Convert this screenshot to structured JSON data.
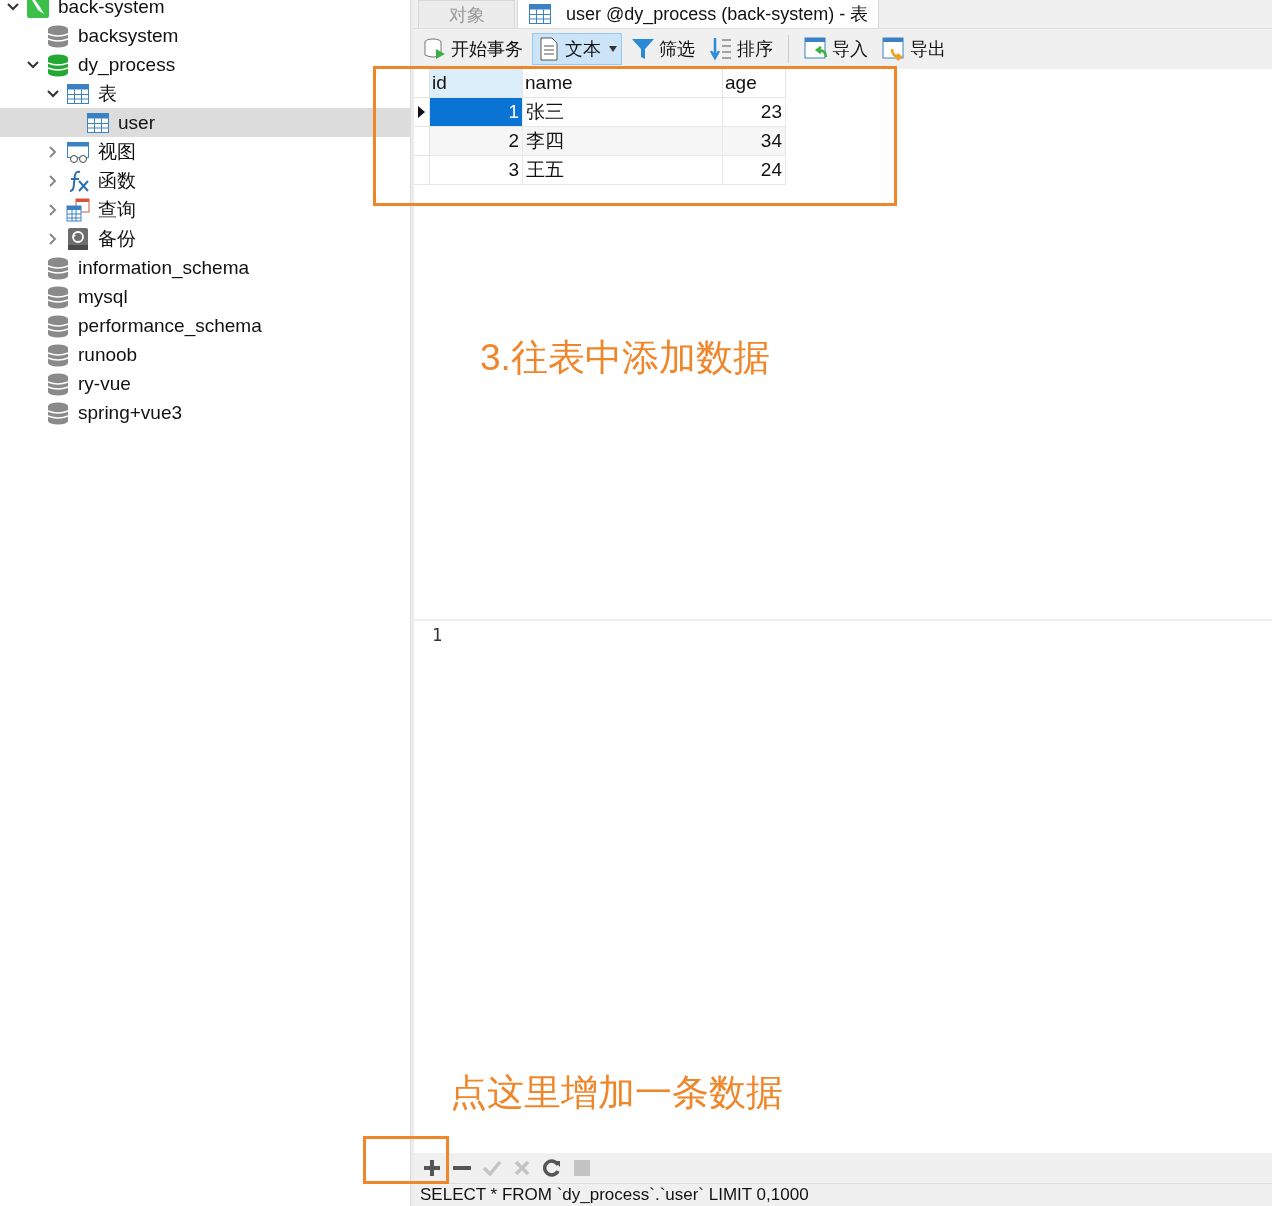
{
  "navigator": {
    "items": [
      {
        "label": "back-system",
        "kind": "connection",
        "expanded": true,
        "selected": false,
        "children": [
          {
            "label": "backsystem",
            "kind": "database",
            "open": false,
            "selected": false
          },
          {
            "label": "dy_process",
            "kind": "database",
            "open": true,
            "expanded": true,
            "selected": false,
            "children": [
              {
                "label": "表",
                "kind": "tables",
                "expanded": true,
                "selected": false,
                "children": [
                  {
                    "label": "user",
                    "kind": "table",
                    "selected": true
                  }
                ]
              },
              {
                "label": "视图",
                "kind": "views",
                "expanded": false,
                "selected": false
              },
              {
                "label": "函数",
                "kind": "functions",
                "expanded": false,
                "selected": false
              },
              {
                "label": "查询",
                "kind": "queries",
                "expanded": false,
                "selected": false
              },
              {
                "label": "备份",
                "kind": "backups",
                "expanded": false,
                "selected": false
              }
            ]
          },
          {
            "label": "information_schema",
            "kind": "database",
            "open": false,
            "selected": false
          },
          {
            "label": "mysql",
            "kind": "database",
            "open": false,
            "selected": false
          },
          {
            "label": "performance_schema",
            "kind": "database",
            "open": false,
            "selected": false
          },
          {
            "label": "runoob",
            "kind": "database",
            "open": false,
            "selected": false
          },
          {
            "label": "ry-vue",
            "kind": "database",
            "open": false,
            "selected": false
          },
          {
            "label": "spring+vue3",
            "kind": "database",
            "open": false,
            "selected": false
          }
        ]
      }
    ]
  },
  "tabs": [
    {
      "label": "对象",
      "kind": "objects",
      "selected": false
    },
    {
      "label": "user @dy_process (back-system) - 表",
      "kind": "table",
      "selected": true
    }
  ],
  "toolbar": [
    {
      "label": "开始事务",
      "kind": "transaction",
      "selected": false
    },
    {
      "label": "文本",
      "kind": "text",
      "selected": true,
      "dropdown": true
    },
    {
      "label": "筛选",
      "kind": "filter",
      "selected": false
    },
    {
      "label": "排序",
      "kind": "sort",
      "selected": false
    },
    {
      "label": "导入",
      "kind": "import",
      "selected": false,
      "separator_before": true
    },
    {
      "label": "导出",
      "kind": "export",
      "selected": false
    }
  ],
  "grid": {
    "columns": [
      "id",
      "name",
      "age"
    ],
    "rows": [
      {
        "cells": [
          "1",
          "张三",
          "23"
        ],
        "selected": true
      },
      {
        "cells": [
          "2",
          "李四",
          "34"
        ],
        "selected": false
      },
      {
        "cells": [
          "3",
          "王五",
          "24"
        ],
        "selected": false
      }
    ]
  },
  "editor": {
    "line_numbers": [
      "1"
    ]
  },
  "record_toolbar": [
    {
      "kind": "add",
      "disabled": false
    },
    {
      "kind": "delete",
      "disabled": false
    },
    {
      "kind": "apply",
      "disabled": true
    },
    {
      "kind": "discard",
      "disabled": true
    },
    {
      "kind": "refresh",
      "disabled": false
    },
    {
      "kind": "stop",
      "disabled": true
    }
  ],
  "status_bar": {
    "sql": "SELECT * FROM `dy_process`.`user` LIMIT 0,1000"
  },
  "annotations": [
    {
      "kind": "box"
    },
    {
      "kind": "note",
      "text": "3.往表中添加数据"
    },
    {
      "kind": "note",
      "text": "点这里增加一条数据"
    },
    {
      "kind": "box"
    }
  ]
}
